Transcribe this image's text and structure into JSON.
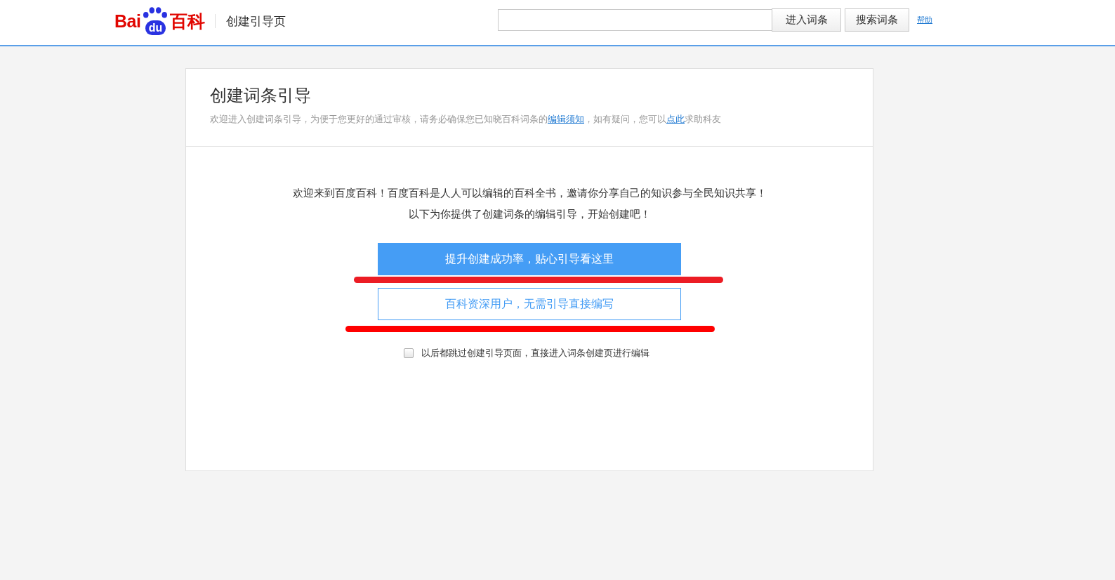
{
  "header": {
    "logo": {
      "text_left": "Bai",
      "badge": "du",
      "text_right": "百科"
    },
    "page_title": "创建引导页",
    "buttons": [
      "进入词条",
      "搜索词条"
    ],
    "help_link": "帮助"
  },
  "card": {
    "title": "创建词条引导",
    "intro": [
      {
        "kind": "text",
        "text": "欢迎进入创建词条引导，为便于您更好的通过审核，请务必确保您已知晓百科词条的"
      },
      {
        "kind": "link",
        "text": "编辑须知"
      },
      {
        "kind": "text",
        "text": "，如有疑问，您可以"
      },
      {
        "kind": "link",
        "text": "点此"
      },
      {
        "kind": "text",
        "text": "求助科友"
      }
    ],
    "welcome": [
      "欢迎来到百度百科！百度百科是人人可以编辑的百科全书，邀请你分享自己的知识参与全民知识共享！",
      "以下为你提供了创建词条的编辑引导，开始创建吧！"
    ],
    "actions": [
      {
        "label": "提升创建成功率，贴心引导看这里",
        "kind": "primary",
        "underlined": true
      },
      {
        "label": "百科资深用户，无需引导直接编写",
        "kind": "outline",
        "underlined": true
      }
    ],
    "skip_option": {
      "label": "以后都跳过创建引导页面，直接进入词条创建页进行编辑",
      "checked": false
    }
  }
}
